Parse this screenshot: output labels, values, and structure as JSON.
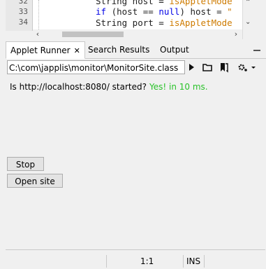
{
  "editor": {
    "line_numbers": [
      "32",
      "33",
      "34"
    ],
    "lines": [
      {
        "parts": [
          {
            "t": "String host = ",
            "c": ""
          },
          {
            "t": "isAppletMode",
            "c": "str"
          }
        ]
      },
      {
        "parts": [
          {
            "t": "if",
            "c": "kw"
          },
          {
            "t": " (host == ",
            "c": ""
          },
          {
            "t": "null",
            "c": "kw"
          },
          {
            "t": ") host = ",
            "c": ""
          },
          {
            "t": "\"",
            "c": "str"
          }
        ]
      },
      {
        "parts": [
          {
            "t": "String port = ",
            "c": ""
          },
          {
            "t": "isAppletMode",
            "c": "str"
          }
        ]
      }
    ]
  },
  "tabs": [
    {
      "label": "Applet Runner",
      "active": true
    },
    {
      "label": "Search Results",
      "active": false
    },
    {
      "label": "Output",
      "active": false
    }
  ],
  "runner": {
    "class_path": "C:\\com\\japplis\\monitor\\MonitorSite.class",
    "status_text": "Is http://localhost:8080/ started?",
    "status_result": "Yes! in 10 ms.",
    "stop_label": "Stop",
    "open_site_label": "Open site",
    "icons": [
      "play-icon",
      "folder-icon",
      "bookmarks-icon",
      "settings-icon"
    ]
  },
  "statusbar": {
    "position": "1:1",
    "mode": "INS"
  },
  "colors": {
    "keyword": "#0000e6",
    "string": "#ce7b00",
    "success": "#29c229"
  }
}
